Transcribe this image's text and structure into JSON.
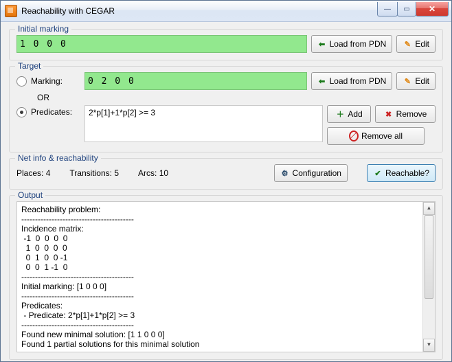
{
  "window": {
    "title": "Reachability with CEGAR"
  },
  "initial": {
    "legend": "Initial marking",
    "value": "1 0 0 0",
    "load_label": "Load from PDN",
    "edit_label": "Edit"
  },
  "target": {
    "legend": "Target",
    "marking_label": "Marking:",
    "marking_value": "0 2 0 0",
    "or_label": "OR",
    "predicates_label": "Predicates:",
    "predicates_value": "2*p[1]+1*p[2] >= 3",
    "load_label": "Load from PDN",
    "edit_label": "Edit",
    "add_label": "Add",
    "remove_label": "Remove",
    "removeall_label": "Remove all"
  },
  "netinfo": {
    "legend": "Net info & reachability",
    "places_label": "Places:",
    "places_value": "4",
    "transitions_label": "Transitions:",
    "transitions_value": "5",
    "arcs_label": "Arcs:",
    "arcs_value": "10",
    "config_label": "Configuration",
    "reachable_label": "Reachable?"
  },
  "output": {
    "legend": "Output",
    "text": "Reachability problem:\n-----------------------------------------\nIncidence matrix:\n -1  0  0  0  0\n  1  0  0  0  0\n  0  1  0  0 -1\n  0  0  1 -1  0\n-----------------------------------------\nInitial marking: [1 0 0 0]\n-----------------------------------------\nPredicates:\n - Predicate: 2*p[1]+1*p[2] >= 3\n-----------------------------------------\nFound new minimal solution: [1 1 0 0 0]\nFound 1 partial solutions for this minimal solution"
  }
}
